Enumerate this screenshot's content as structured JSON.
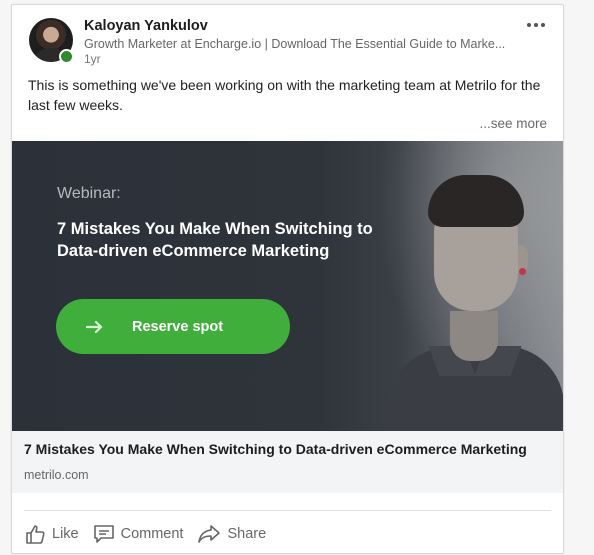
{
  "post": {
    "author": {
      "name": "Kaloyan Yankulov",
      "headline": "Growth Marketer at Encharge.io | Download The Essential Guide to Marke...",
      "time": "1yr",
      "presence_color": "#2e8b2e"
    },
    "text": "This is something we've been working on with the marketing team at Metrilo for the last few weeks.",
    "see_more_label": "...see more",
    "banner": {
      "label": "Webinar:",
      "title": "7 Mistakes You Make When Switching to Data-driven eCommerce Marketing",
      "cta_label": "Reserve spot",
      "cta_color": "#3fae3a"
    },
    "link": {
      "title": "7 Mistakes You Make When Switching to Data-driven eCommerce Marketing",
      "domain": "metrilo.com"
    },
    "actions": {
      "like_label": "Like",
      "comment_label": "Comment",
      "share_label": "Share"
    }
  }
}
